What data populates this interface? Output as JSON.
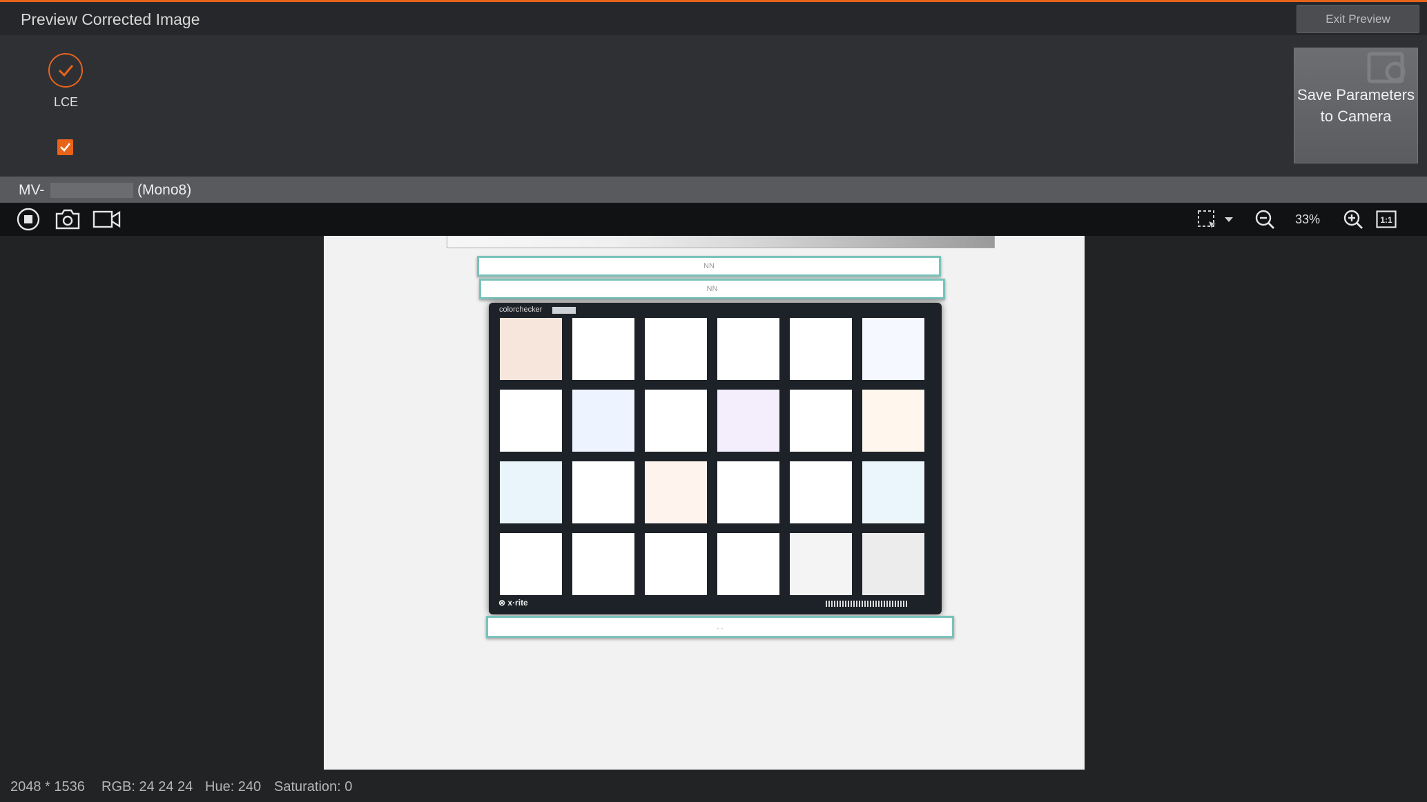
{
  "window": {
    "title": "Preview Corrected Image",
    "exit_label": "Exit Preview"
  },
  "tools": {
    "lce_label": "LCE",
    "lce_checked": true
  },
  "actions": {
    "save_label_line1": "Save Parameters",
    "save_label_line2": "to Camera"
  },
  "camera": {
    "name_prefix": "MV-",
    "pixel_format": "(Mono8)"
  },
  "toolbar": {
    "zoom_level": "33%",
    "actual_size_label": "1:1",
    "icons": [
      "stop-icon",
      "snapshot-camera-icon",
      "record-video-icon",
      "roi-select-icon",
      "chevron-down-icon",
      "zoom-out-icon",
      "zoom-in-icon",
      "actual-size-icon"
    ]
  },
  "image": {
    "board_brand": "colorchecker",
    "board_logo": "⊗ x·rite",
    "strip_top_1": "NN",
    "strip_top_2": "NN",
    "strip_bottom": ". ."
  },
  "status": {
    "resolution": "2048 * 1536",
    "rgb": "RGB: 24 24 24",
    "hue": "Hue: 240",
    "saturation": "Saturation: 0"
  },
  "colors": {
    "accent": "#e8641b",
    "panel": "#2f3034",
    "camera_bar": "#585a5e",
    "toolbar": "#111214"
  }
}
